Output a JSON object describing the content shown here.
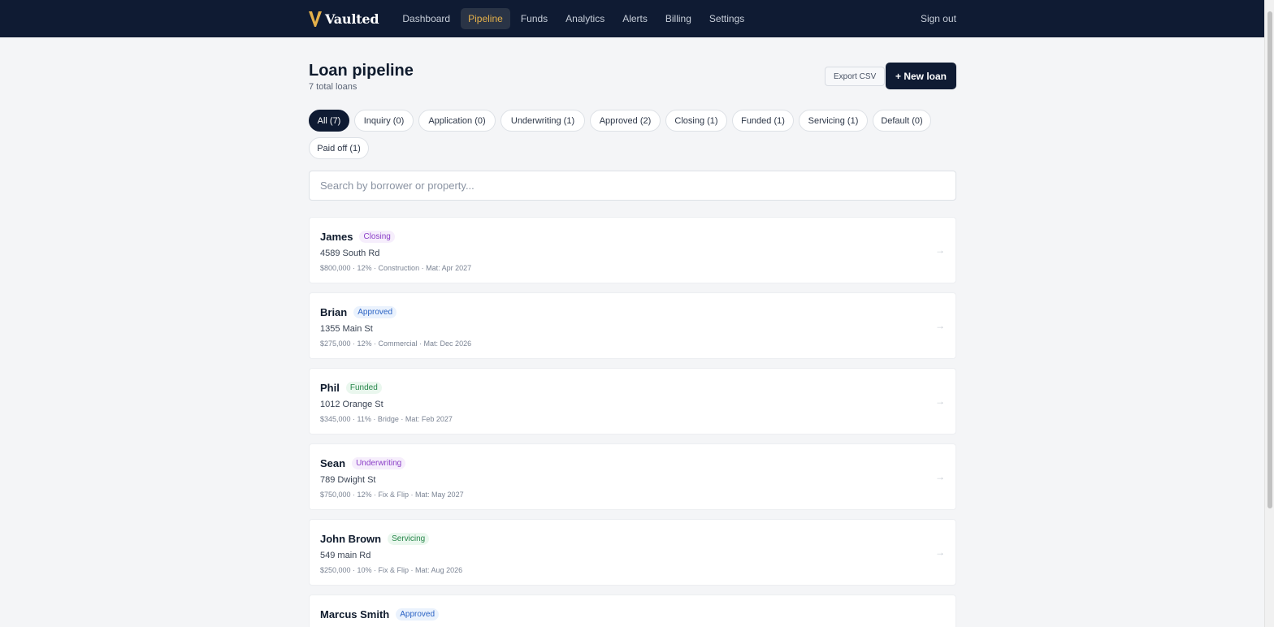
{
  "app": {
    "name": "Vaulted",
    "logo_letter": "V",
    "brand_color": "#e4b04a"
  },
  "nav": {
    "items": [
      {
        "label": "Dashboard",
        "active": false
      },
      {
        "label": "Pipeline",
        "active": true
      },
      {
        "label": "Funds",
        "active": false
      },
      {
        "label": "Analytics",
        "active": false
      },
      {
        "label": "Alerts",
        "active": false
      },
      {
        "label": "Billing",
        "active": false
      },
      {
        "label": "Settings",
        "active": false
      }
    ],
    "signout_label": "Sign out"
  },
  "page": {
    "title": "Loan pipeline",
    "subtitle": "7 total loans",
    "export_label": "Export CSV",
    "new_loan_label": "+ New loan"
  },
  "filters": [
    {
      "label": "All (7)",
      "active": true
    },
    {
      "label": "Inquiry (0)",
      "active": false
    },
    {
      "label": "Application (0)",
      "active": false
    },
    {
      "label": "Underwriting (1)",
      "active": false
    },
    {
      "label": "Approved (2)",
      "active": false
    },
    {
      "label": "Closing (1)",
      "active": false
    },
    {
      "label": "Funded (1)",
      "active": false
    },
    {
      "label": "Servicing (1)",
      "active": false
    },
    {
      "label": "Default (0)",
      "active": false
    },
    {
      "label": "Paid off (1)",
      "active": false
    }
  ],
  "search": {
    "placeholder": "Search by borrower or property...",
    "value": ""
  },
  "loans": [
    {
      "name": "James",
      "status": "Closing",
      "status_color": "purple",
      "address": "4589 South Rd",
      "meta": "$800,000 · 12% · Construction · Mat: Apr 2027"
    },
    {
      "name": "Brian",
      "status": "Approved",
      "status_color": "blue",
      "address": "1355 Main St",
      "meta": "$275,000 · 12% · Commercial · Mat: Dec 2026"
    },
    {
      "name": "Phil",
      "status": "Funded",
      "status_color": "green",
      "address": "1012 Orange St",
      "meta": "$345,000 · 11% · Bridge · Mat: Feb 2027"
    },
    {
      "name": "Sean",
      "status": "Underwriting",
      "status_color": "purple",
      "address": "789 Dwight St",
      "meta": "$750,000 · 12% · Fix & Flip · Mat: May 2027"
    },
    {
      "name": "John Brown",
      "status": "Servicing",
      "status_color": "green",
      "address": "549 main Rd",
      "meta": "$250,000 · 10% · Fix & Flip · Mat: Aug 2026"
    },
    {
      "name": "Marcus Smith",
      "status": "Approved",
      "status_color": "blue",
      "address": "",
      "meta": ""
    }
  ],
  "row_arrow": "→"
}
